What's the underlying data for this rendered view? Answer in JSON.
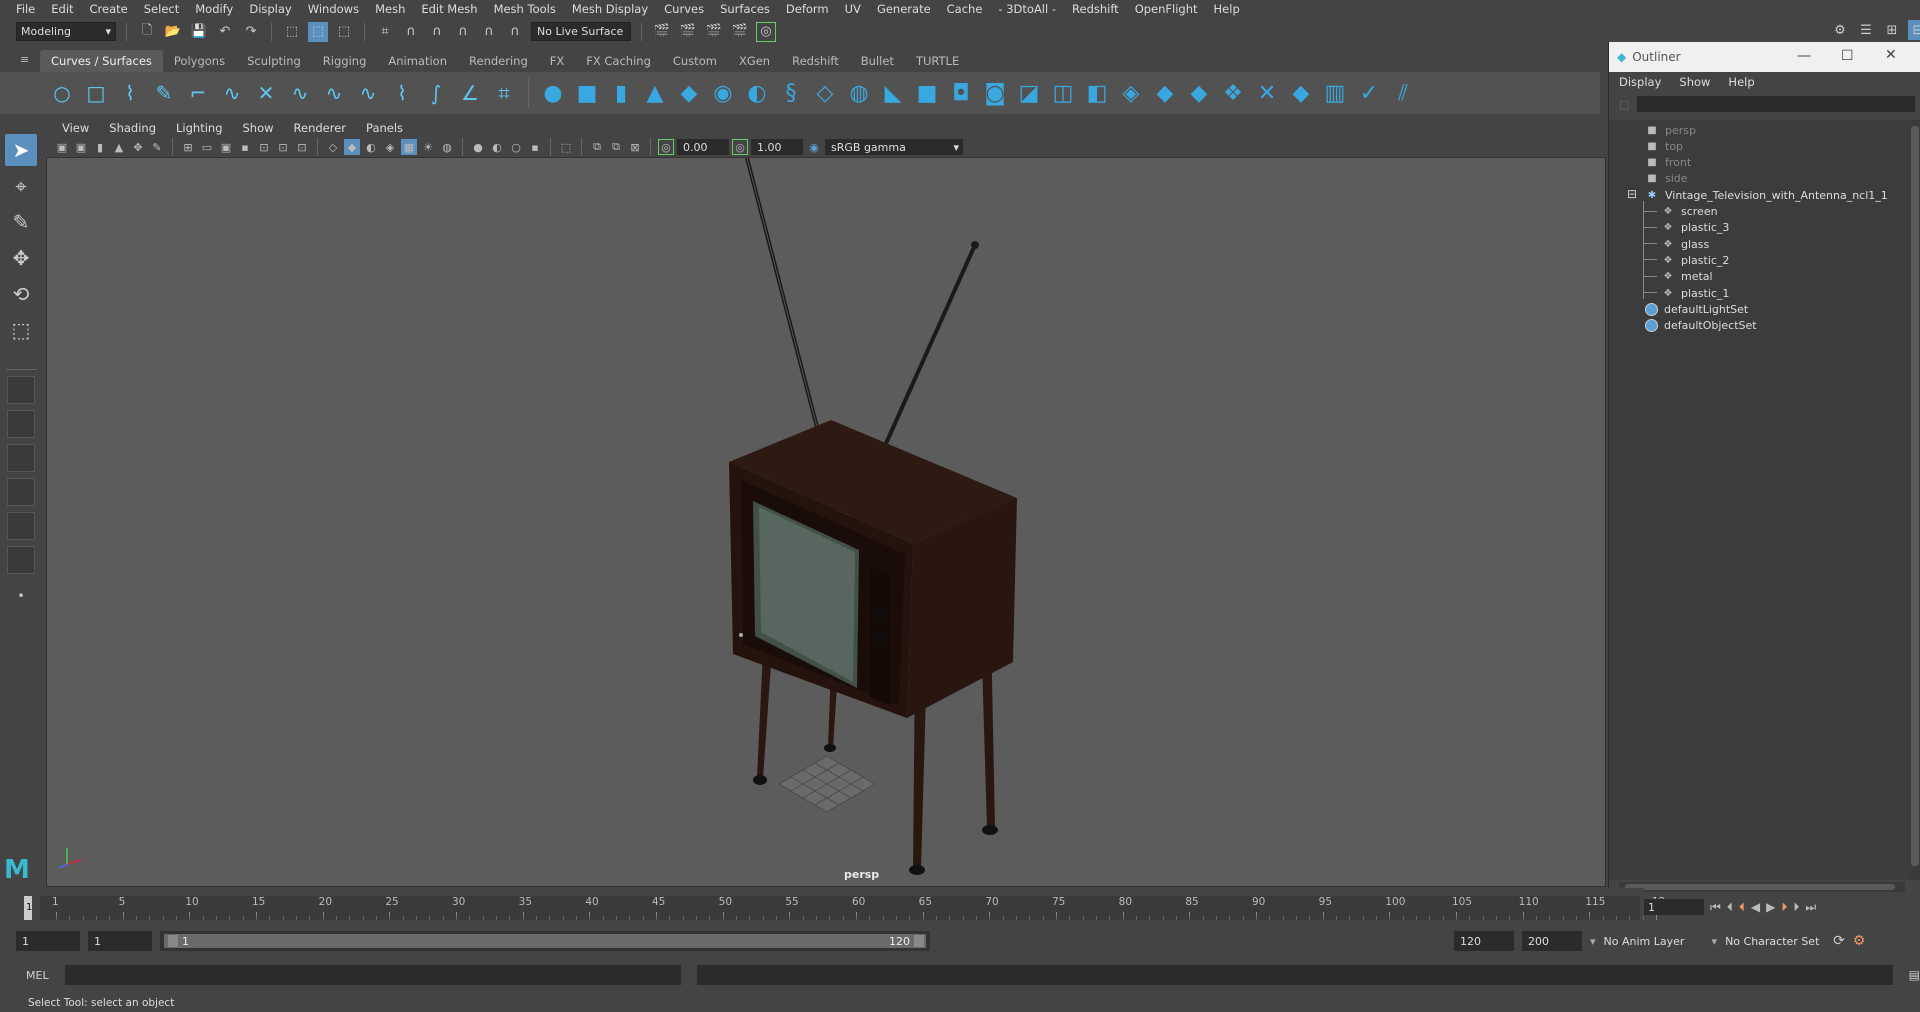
{
  "menubar": [
    "File",
    "Edit",
    "Create",
    "Select",
    "Modify",
    "Display",
    "Windows",
    "Mesh",
    "Edit Mesh",
    "Mesh Tools",
    "Mesh Display",
    "Curves",
    "Surfaces",
    "Deform",
    "UV",
    "Generate",
    "Cache",
    "- 3DtoAll -",
    "Redshift",
    "OpenFlight",
    "Help"
  ],
  "statusline": {
    "mode": "Modeling",
    "live_surface": "No Live Surface"
  },
  "shelf_tabs": [
    "Curves / Surfaces",
    "Polygons",
    "Sculpting",
    "Rigging",
    "Animation",
    "Rendering",
    "FX",
    "FX Caching",
    "Custom",
    "XGen",
    "Redshift",
    "Bullet",
    "TURTLE"
  ],
  "shelf_active_tab": "Curves / Surfaces",
  "viewport": {
    "menu": [
      "View",
      "Shading",
      "Lighting",
      "Show",
      "Renderer",
      "Panels"
    ],
    "field_a": "0.00",
    "field_b": "1.00",
    "color_space": "sRGB gamma",
    "camera_label": "persp"
  },
  "outliner": {
    "title": "Outliner",
    "menu": [
      "Display",
      "Show",
      "Help"
    ],
    "items": [
      {
        "label": "persp",
        "icon": "camera-icon",
        "dim": true
      },
      {
        "label": "top",
        "icon": "camera-icon",
        "dim": true
      },
      {
        "label": "front",
        "icon": "camera-icon",
        "dim": true
      },
      {
        "label": "side",
        "icon": "camera-icon",
        "dim": true
      },
      {
        "label": "Vintage_Television_with_Antenna_ncl1_1",
        "icon": "group-icon",
        "dim": false
      },
      {
        "label": "screen",
        "icon": "mesh-icon",
        "dim": false
      },
      {
        "label": "plastic_3",
        "icon": "mesh-icon",
        "dim": false
      },
      {
        "label": "glass",
        "icon": "mesh-icon",
        "dim": false
      },
      {
        "label": "plastic_2",
        "icon": "mesh-icon",
        "dim": false
      },
      {
        "label": "metal",
        "icon": "mesh-icon",
        "dim": false
      },
      {
        "label": "plastic_1",
        "icon": "mesh-icon",
        "dim": false
      },
      {
        "label": "defaultLightSet",
        "icon": "set-icon",
        "dim": false
      },
      {
        "label": "defaultObjectSet",
        "icon": "set-icon",
        "dim": false
      }
    ]
  },
  "timeline": {
    "ticks": [
      "1",
      "5",
      "10",
      "15",
      "20",
      "25",
      "30",
      "35",
      "40",
      "45",
      "50",
      "55",
      "60",
      "65",
      "70",
      "75",
      "80",
      "85",
      "90",
      "95",
      "100",
      "105",
      "110",
      "115",
      "12"
    ],
    "current_frame": "1"
  },
  "range": {
    "start": "1",
    "anim_start": "1",
    "range_start_label": "1",
    "range_end_label": "120",
    "anim_end": "120",
    "end": "200",
    "anim_layer": "No Anim Layer",
    "character_set": "No Character Set"
  },
  "cmdline": {
    "label": "MEL"
  },
  "helpline": {
    "text": "Select Tool: select an object"
  }
}
